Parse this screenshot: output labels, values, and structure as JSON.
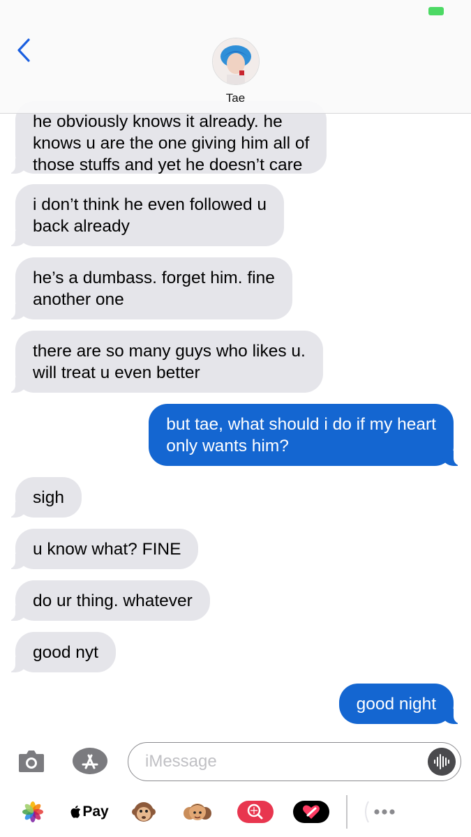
{
  "header": {
    "contact_name": "Tae",
    "back_icon": "chevron-left-icon"
  },
  "messages": [
    {
      "dir": "in",
      "lines": [
        "he obviously knows it already. he",
        "knows u are the one giving him all of",
        "those stuffs and yet he doesn’t care"
      ]
    },
    {
      "dir": "in",
      "lines": [
        "i don’t think he even followed u",
        "back already"
      ]
    },
    {
      "dir": "in",
      "lines": [
        "he’s a dumbass. forget him. fine",
        "another one"
      ]
    },
    {
      "dir": "in",
      "lines": [
        "there are so many guys who likes u.",
        "will treat u even better"
      ]
    },
    {
      "dir": "out",
      "lines": [
        "but tae, what should i do if my heart",
        "only wants him?"
      ]
    },
    {
      "dir": "in",
      "lines": [
        "sigh"
      ]
    },
    {
      "dir": "in",
      "lines": [
        "u know what? FINE"
      ]
    },
    {
      "dir": "in",
      "lines": [
        "do ur thing. whatever"
      ]
    },
    {
      "dir": "in",
      "lines": [
        "good nyt"
      ]
    },
    {
      "dir": "out",
      "lines": [
        "good night"
      ]
    }
  ],
  "composer": {
    "placeholder": "iMessage",
    "value": ""
  },
  "app_drawer": {
    "pay_label": "Pay"
  },
  "colors": {
    "incoming": "#e5e5ea",
    "outgoing": "#1466d1",
    "battery": "#4cd964"
  }
}
